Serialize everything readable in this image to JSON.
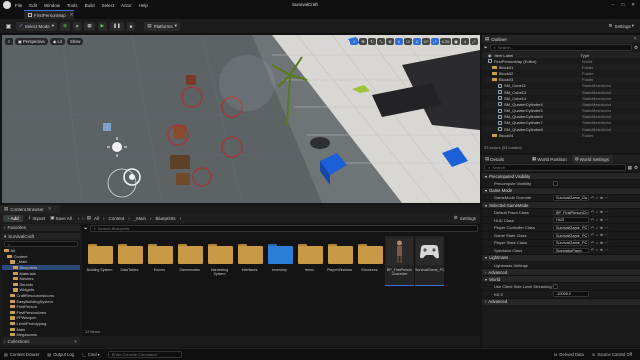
{
  "window": {
    "app_title": "SurvivalCraft",
    "menu": [
      "File",
      "Edit",
      "Window",
      "Tools",
      "Build",
      "Select",
      "Actor",
      "Help"
    ],
    "doc_tab": "FirstPersonMap"
  },
  "toolbar": {
    "select_mode": "Select Mode",
    "platforms": "Platforms",
    "settings": "Settings"
  },
  "viewport": {
    "perspective": "Perspective",
    "lit": "Lit",
    "show": "Show",
    "snap_value": "10",
    "angle_value": "10°",
    "scale_value": "0.25",
    "cam_speed": "4"
  },
  "outliner": {
    "title": "Outliner",
    "search_placeholder": "Search...",
    "col_label": "Item Label",
    "col_type": "Type",
    "rows": [
      {
        "name": "FirstPersonMap (Editor)",
        "type": "World",
        "kind": "world"
      },
      {
        "name": "Block01",
        "type": "Folder",
        "kind": "folder"
      },
      {
        "name": "Block02",
        "type": "Folder",
        "kind": "folder"
      },
      {
        "name": "Block03",
        "type": "Folder",
        "kind": "folder"
      },
      {
        "name": "SM_Cube11",
        "type": "StaticMeshActor",
        "kind": "mesh"
      },
      {
        "name": "SM_Cube13",
        "type": "StaticMeshActor",
        "kind": "mesh"
      },
      {
        "name": "SM_Cube14",
        "type": "StaticMeshActor",
        "kind": "mesh"
      },
      {
        "name": "SM_QuarterCylinder4",
        "type": "StaticMeshActor",
        "kind": "mesh"
      },
      {
        "name": "SM_QuarterCylinder5",
        "type": "StaticMeshActor",
        "kind": "mesh"
      },
      {
        "name": "SM_QuarterCylinder6",
        "type": "StaticMeshActor",
        "kind": "mesh"
      },
      {
        "name": "SM_QuarterCylinder7",
        "type": "StaticMeshActor",
        "kind": "mesh"
      },
      {
        "name": "SM_QuarterCylinder8",
        "type": "StaticMeshActor",
        "kind": "mesh"
      },
      {
        "name": "Block04",
        "type": "Folder",
        "kind": "folder"
      }
    ],
    "footer": "53 actors (53 loaded)"
  },
  "details": {
    "tabs": [
      "Details",
      "World Partition",
      "World Settings"
    ],
    "search_placeholder": "Search",
    "sections": [
      {
        "title": "Precomputed Visibility",
        "props": [
          {
            "label": "Precompute Visibility",
            "kind": "check"
          }
        ]
      },
      {
        "title": "Game Mode",
        "props": [
          {
            "label": "GameMode Override",
            "value": "SurvivalGame_Ga",
            "kind": "combo"
          }
        ]
      },
      {
        "title": "Selected GameMode",
        "props": [
          {
            "label": "Default Pawn Class",
            "value": "BP_FirstPersonCh",
            "kind": "combo"
          },
          {
            "label": "HUD Class",
            "value": "HUD",
            "kind": "combo"
          },
          {
            "label": "Player Controller Class",
            "value": "SurvivalGame_PC",
            "kind": "combo"
          },
          {
            "label": "Game State Class",
            "value": "SurvivalGame_PC",
            "kind": "combo"
          },
          {
            "label": "Player State Class",
            "value": "SurvivalGame_PC",
            "kind": "combo"
          },
          {
            "label": "Spectator Class",
            "value": "SpectatorPawn",
            "kind": "combo"
          }
        ]
      },
      {
        "title": "Lightmass",
        "props": [
          {
            "label": "Lightmass Settings",
            "kind": "none"
          }
        ]
      },
      {
        "title": "Advanced",
        "props": []
      },
      {
        "title": "World",
        "props": [
          {
            "label": "Use Client Side Level Streaming Volu",
            "kind": "check"
          },
          {
            "label": "Kill Z",
            "value": "-10000.0",
            "kind": "text"
          }
        ]
      },
      {
        "title": "Advanced",
        "props": []
      }
    ]
  },
  "content_browser": {
    "tab": "Content Browser",
    "add": "Add",
    "import": "Import",
    "save_all": "Save All",
    "settings": "Settings",
    "breadcrumb": [
      "All",
      "Content",
      "_Main",
      "Blueprints"
    ],
    "search_placeholder": "Search Blueprints",
    "favorites": "Favorites",
    "project": "SurvivalCraft",
    "tree": [
      {
        "label": "All",
        "indent": 0
      },
      {
        "label": "Content",
        "indent": 1
      },
      {
        "label": "_Main",
        "indent": 2
      },
      {
        "label": "Blueprints",
        "indent": 3,
        "selected": true
      },
      {
        "label": "Materials",
        "indent": 3
      },
      {
        "label": "Meshes",
        "indent": 3
      },
      {
        "label": "Sounds",
        "indent": 3
      },
      {
        "label": "Widgets",
        "indent": 3
      },
      {
        "label": "CraftResourcesIcons",
        "indent": 2
      },
      {
        "label": "EasyBuildingSystem",
        "indent": 2
      },
      {
        "label": "FirstPerson",
        "indent": 2
      },
      {
        "label": "FirstPersonArms",
        "indent": 2
      },
      {
        "label": "FPWeapon",
        "indent": 2
      },
      {
        "label": "LevelPrototyping",
        "indent": 2
      },
      {
        "label": "Main",
        "indent": 2
      },
      {
        "label": "Megascans",
        "indent": 2
      },
      {
        "label": "MilitaryWeapDark",
        "indent": 2
      }
    ],
    "collections": "Collections",
    "assets": [
      {
        "label": "Building System",
        "kind": "folder"
      },
      {
        "label": "DataTables",
        "kind": "folder"
      },
      {
        "label": "Enums",
        "kind": "folder"
      },
      {
        "label": "Gamemodes",
        "kind": "folder"
      },
      {
        "label": "Harvesting System",
        "kind": "folder"
      },
      {
        "label": "Interfaces",
        "kind": "folder"
      },
      {
        "label": "Inventory",
        "kind": "folder-blue"
      },
      {
        "label": "Items",
        "kind": "folder"
      },
      {
        "label": "PlayerWindows",
        "kind": "folder"
      },
      {
        "label": "Structures",
        "kind": "folder"
      },
      {
        "label": "BP_FirstPerson Character",
        "kind": "character"
      },
      {
        "label": "SurvivalGame_PC",
        "kind": "controller"
      }
    ],
    "item_count": "12 items"
  },
  "statusbar": {
    "content_drawer": "Content Drawer",
    "output_log": "Output Log",
    "cmd": "Cmd",
    "cmd_placeholder": "Enter Console Command",
    "derived_data": "Derived Data",
    "source_control": "Source Control Off"
  }
}
